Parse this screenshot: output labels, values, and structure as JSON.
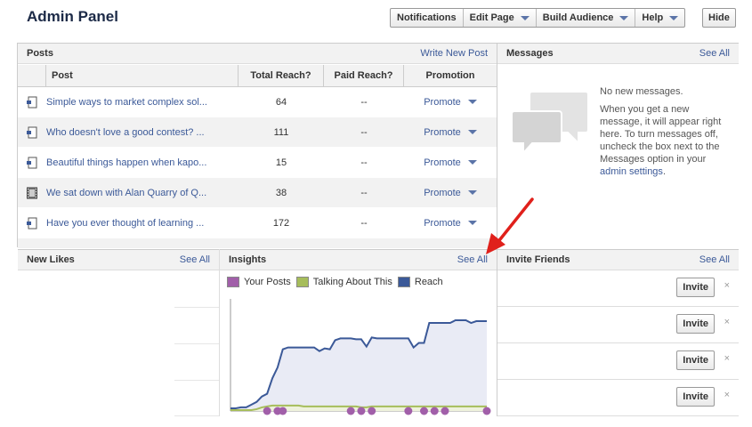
{
  "header": {
    "title": "Admin Panel",
    "buttons": [
      "Notifications",
      "Edit Page",
      "Build Audience",
      "Help"
    ],
    "hide_label": "Hide"
  },
  "posts": {
    "title": "Posts",
    "action": "Write New Post",
    "columns": [
      "Post",
      "Total Reach?",
      "Paid Reach?",
      "Promotion"
    ],
    "rows": [
      {
        "icon": "status-icon",
        "post": "Simple ways to market complex sol...",
        "total_reach": "64",
        "paid_reach": "--",
        "promotion": "Promote"
      },
      {
        "icon": "status-icon",
        "post": "Who doesn't love a good contest? ...",
        "total_reach": "111",
        "paid_reach": "--",
        "promotion": "Promote"
      },
      {
        "icon": "status-icon",
        "post": "Beautiful things happen when kapo...",
        "total_reach": "15",
        "paid_reach": "--",
        "promotion": "Promote"
      },
      {
        "icon": "video-icon",
        "post": "We sat down with Alan Quarry of Q...",
        "total_reach": "38",
        "paid_reach": "--",
        "promotion": "Promote"
      },
      {
        "icon": "status-icon",
        "post": "Have you ever thought of learning ...",
        "total_reach": "172",
        "paid_reach": "--",
        "promotion": "Promote"
      }
    ]
  },
  "messages": {
    "title": "Messages",
    "see_all": "See All",
    "none": "No new messages.",
    "help": "When you get a new message, it will appear right here. To turn messages off, uncheck the box next to the Messages option in your",
    "link": "admin settings",
    "end": "."
  },
  "new_likes": {
    "title": "New Likes",
    "see_all": "See All"
  },
  "insights": {
    "title": "Insights",
    "see_all": "See All",
    "legend": [
      {
        "name": "Your Posts",
        "color": "#a15fa9"
      },
      {
        "name": "Talking About This",
        "color": "#a6bd5b"
      },
      {
        "name": "Reach",
        "color": "#3b5998"
      }
    ]
  },
  "invite_friends": {
    "title": "Invite Friends",
    "see_all": "See All",
    "rows": [
      {
        "button": "Invite",
        "close": "×"
      },
      {
        "button": "Invite",
        "close": "×"
      },
      {
        "button": "Invite",
        "close": "×"
      },
      {
        "button": "Invite",
        "close": "×"
      }
    ]
  },
  "chart_data": {
    "type": "line",
    "series": [
      {
        "name": "Reach",
        "values": [
          3,
          3,
          4,
          4,
          7,
          10,
          16,
          19,
          36,
          48,
          68,
          70,
          70,
          70,
          70,
          70,
          70,
          66,
          69,
          68,
          78,
          80,
          80,
          80,
          79,
          79,
          71,
          81,
          80,
          80,
          80,
          80,
          80,
          80,
          80,
          70,
          75,
          75,
          97,
          97,
          97,
          97,
          97,
          100,
          100,
          100,
          97,
          99,
          99,
          99
        ]
      },
      {
        "name": "Talking About This",
        "values": [
          1,
          1,
          1,
          1,
          1,
          2,
          4,
          5,
          6,
          6,
          6,
          6,
          6,
          6,
          5,
          5,
          5,
          5,
          5,
          5,
          5,
          5,
          5,
          5,
          5,
          4,
          4,
          5,
          5,
          5,
          5,
          5,
          5,
          5,
          5,
          5,
          5,
          5,
          5,
          5,
          5,
          5,
          5,
          5,
          5,
          5,
          5,
          5,
          5,
          5
        ]
      },
      {
        "name": "Your Posts",
        "x_index": [
          7,
          9,
          10,
          23,
          25,
          27,
          34,
          37,
          39,
          41,
          49
        ]
      }
    ],
    "grid": true,
    "legend": "top"
  }
}
